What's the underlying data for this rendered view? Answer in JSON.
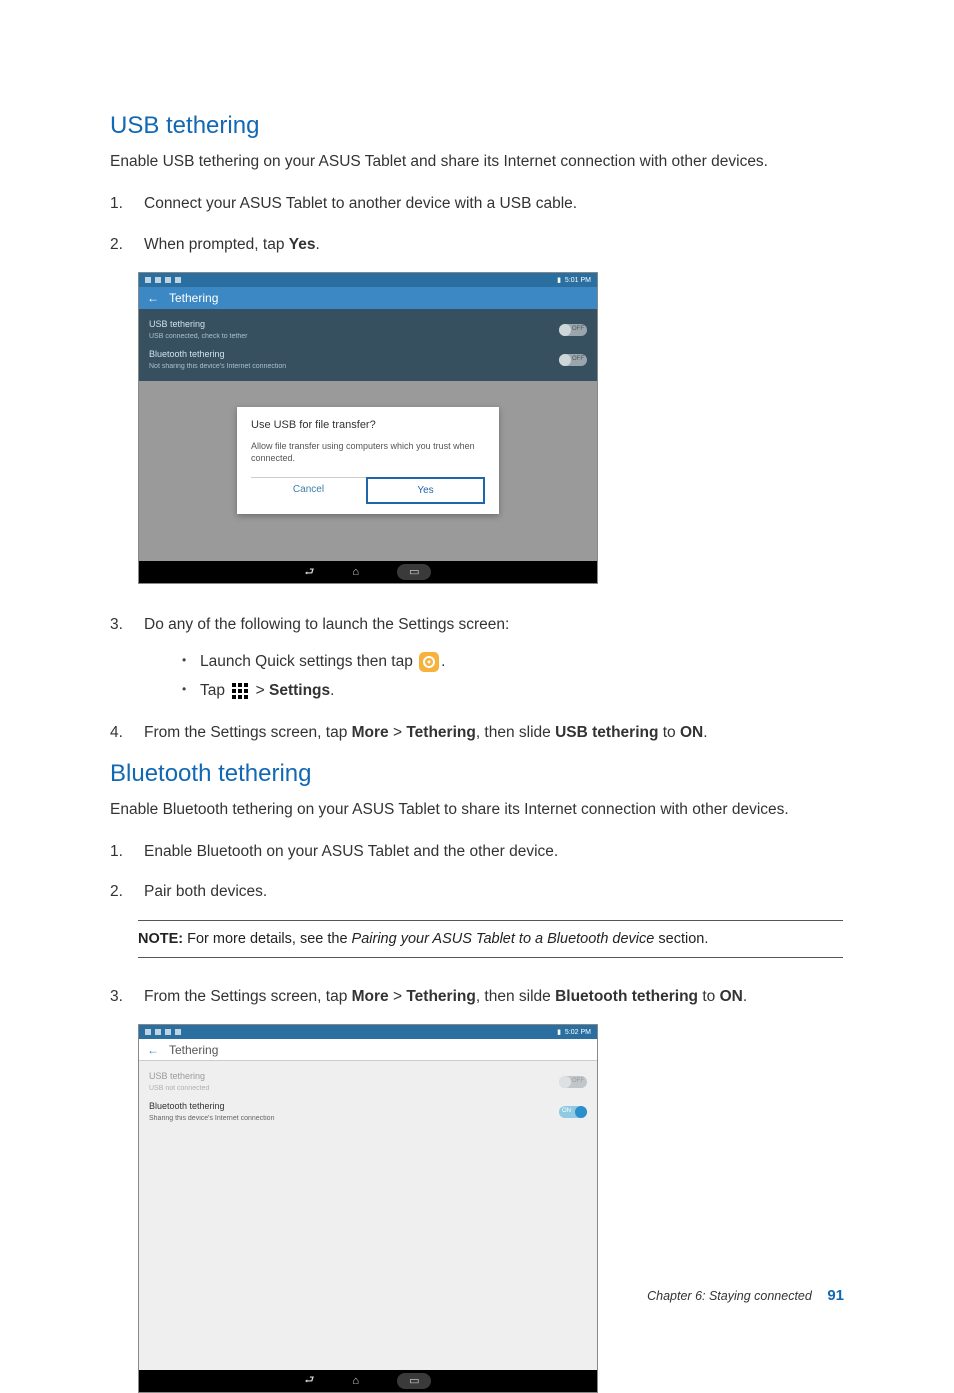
{
  "usb_section": {
    "heading": "USB tethering",
    "intro": "Enable USB tethering on your ASUS Tablet and share its Internet connection with other devices.",
    "steps": {
      "s1_num": "1.",
      "s1": "Connect your ASUS Tablet to another device with a USB cable.",
      "s2_num": "2.",
      "s2_pre": "When prompted, tap ",
      "s2_bold": "Yes",
      "s2_post": ".",
      "s3_num": "3.",
      "s3": "Do any of the following to launch the Settings screen:",
      "s3a_pre": "Launch Quick settings then tap ",
      "s3a_post": ".",
      "s3b_pre": "Tap ",
      "s3b_mid": " > ",
      "s3b_bold": "Settings",
      "s3b_post": ".",
      "s4_num": "4.",
      "s4_pre": "From the Settings screen, tap ",
      "s4_b1": "More",
      "s4_g1": " > ",
      "s4_b2": "Tethering",
      "s4_g2": ", then slide ",
      "s4_b3": "USB tethering",
      "s4_g3": " to ",
      "s4_b4": "ON",
      "s4_post": "."
    }
  },
  "bt_section": {
    "heading": "Bluetooth tethering",
    "intro": "Enable Bluetooth tethering on your ASUS Tablet to share its Internet connection with other devices.",
    "steps": {
      "s1_num": "1.",
      "s1": "Enable Bluetooth on your ASUS Tablet and the other device.",
      "s2_num": "2.",
      "s2": "Pair both devices.",
      "s3_num": "3.",
      "s3_pre": "From the Settings screen, tap ",
      "s3_b1": "More",
      "s3_g1": " > ",
      "s3_b2": "Tethering",
      "s3_g2": ", then silde ",
      "s3_b3": "Bluetooth tethering",
      "s3_g3": " to ",
      "s3_b4": "ON",
      "s3_post": "."
    },
    "note_label": "NOTE:",
    "note_pre": " For more details, see the ",
    "note_italic": "Pairing your ASUS Tablet to a Bluetooth device",
    "note_post": " section."
  },
  "shot1": {
    "time": "5:01 PM",
    "header": "Tethering",
    "row1_title": "USB tethering",
    "row1_desc": "USB connected, check to tether",
    "row2_title": "Bluetooth tethering",
    "row2_desc": "Not sharing this device's Internet connection",
    "toggle_off": "OFF",
    "dialog_title": "Use USB for file transfer?",
    "dialog_desc": "Allow file transfer using computers which you trust when connected.",
    "btn_cancel": "Cancel",
    "btn_yes": "Yes"
  },
  "shot2": {
    "time": "5:02 PM",
    "header": "Tethering",
    "row1_title": "USB tethering",
    "row1_desc": "USB not connected",
    "row2_title": "Bluetooth tethering",
    "row2_desc": "Sharing this device's Internet connection",
    "toggle_off": "OFF",
    "toggle_on": "ON"
  },
  "footer": {
    "chapter": "Chapter 6: Staying connected",
    "page": "91"
  }
}
